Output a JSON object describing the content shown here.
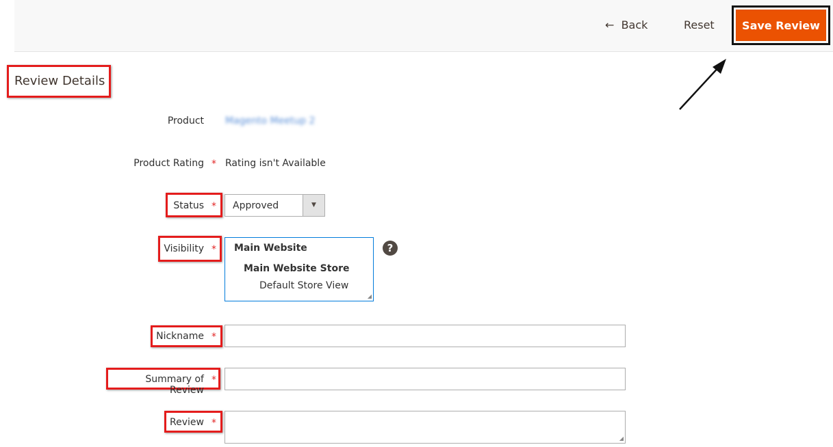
{
  "toolbar": {
    "back_label": "Back",
    "reset_label": "Reset",
    "save_label": "Save Review"
  },
  "section_title": "Review Details",
  "form": {
    "product": {
      "label": "Product",
      "value": "Magento Meetup 2"
    },
    "rating": {
      "label": "Product Rating",
      "value": "Rating isn't Available"
    },
    "status": {
      "label": "Status",
      "value": "Approved"
    },
    "visibility": {
      "label": "Visibility",
      "options": [
        "Main Website",
        "Main Website Store",
        "Default Store View"
      ]
    },
    "nickname": {
      "label": "Nickname",
      "value": ""
    },
    "summary": {
      "label": "Summary of Review",
      "value": ""
    },
    "review": {
      "label": "Review",
      "value": ""
    },
    "required_mark": "*"
  },
  "colors": {
    "accent": "#eb5202",
    "highlight": "#e41c1c",
    "required": "#e22626"
  }
}
